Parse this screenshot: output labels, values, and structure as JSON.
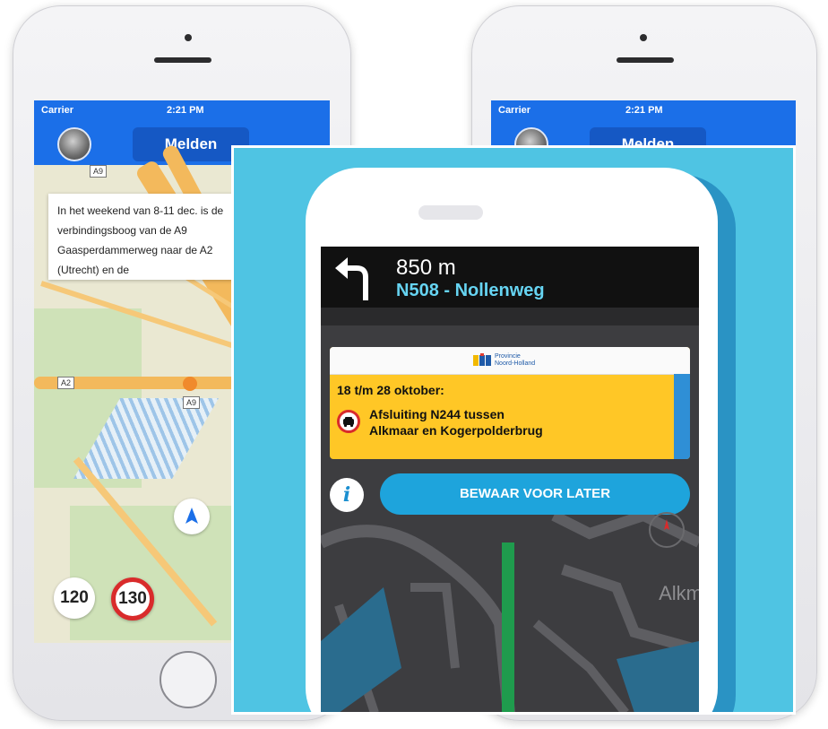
{
  "left_phone": {
    "status": {
      "carrier": "Carrier",
      "time": "2:21 PM"
    },
    "header": {
      "button_label": "Melden"
    },
    "info_card": {
      "text": "In het weekend van 8-11 dec. is de verbindingsboog van de A9 Gaasperdammerweg naar de A2 (Utrecht) en de"
    },
    "road_shields": {
      "a9": "A9",
      "a2": "A2",
      "a9b": "A9"
    },
    "speeds": {
      "first": "120",
      "second": "130"
    }
  },
  "right_phone": {
    "status": {
      "carrier": "Carrier",
      "time": "2:21 PM"
    },
    "header": {
      "button_label": "Melden"
    }
  },
  "navigation": {
    "distance": "850 m",
    "road": "N508 - Nollenweg",
    "turn_icon": "turn-left-arrow-icon"
  },
  "notification": {
    "logo_text_line1": "Provincie",
    "logo_text_line2": "Noord-Holland",
    "date": "18 t/m 28 oktober:",
    "line1": "Afsluiting N244 tussen",
    "line2": "Alkmaar en Kogerpolderbrug",
    "icon": "no-cars-icon"
  },
  "actions": {
    "info_label": "i",
    "save_label": "BEWAAR VOOR LATER"
  },
  "map": {
    "place_label": "Alkm"
  },
  "colors": {
    "accent_blue": "#1b6fe8",
    "panel_cyan": "#4fc4e3",
    "notif_yellow": "#ffc726",
    "button_blue": "#1ea4dc"
  }
}
